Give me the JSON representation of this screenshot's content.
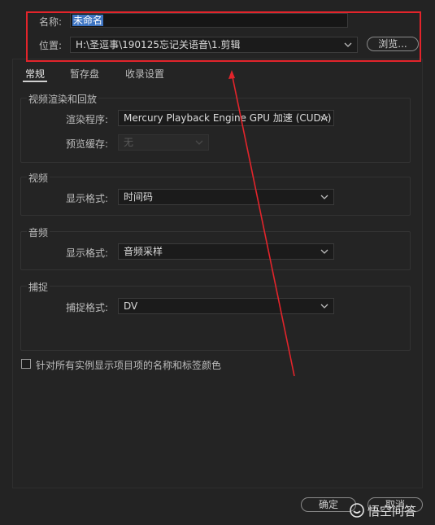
{
  "header": {
    "name_label": "名称:",
    "name_value": "未命名",
    "location_label": "位置:",
    "location_value": "H:\\圣逗事\\190125忘记关语音\\1.剪辑",
    "browse_label": "浏览..."
  },
  "tabs": [
    {
      "label": "常规",
      "active": true
    },
    {
      "label": "暂存盘",
      "active": false
    },
    {
      "label": "收录设置",
      "active": false
    }
  ],
  "groups": {
    "render": {
      "title": "视频渲染和回放",
      "renderer_label": "渲染程序:",
      "renderer_value": "Mercury Playback Engine GPU 加速 (CUDA)",
      "preview_cache_label": "预览缓存:",
      "preview_cache_value": "无"
    },
    "video": {
      "title": "视频",
      "display_format_label": "显示格式:",
      "display_format_value": "时间码"
    },
    "audio": {
      "title": "音频",
      "display_format_label": "显示格式:",
      "display_format_value": "音频采样"
    },
    "capture": {
      "title": "捕捉",
      "capture_format_label": "捕捉格式:",
      "capture_format_value": "DV"
    }
  },
  "checkbox": {
    "label": "针对所有实例显示项目项的名称和标签颜色",
    "checked": false
  },
  "footer": {
    "ok_label": "确定",
    "cancel_label": "取消"
  },
  "watermark": {
    "text": "悟空问答"
  },
  "colors": {
    "background": "#232323",
    "annotation_red": "#e3242b",
    "selection_blue": "#3d74c2"
  }
}
